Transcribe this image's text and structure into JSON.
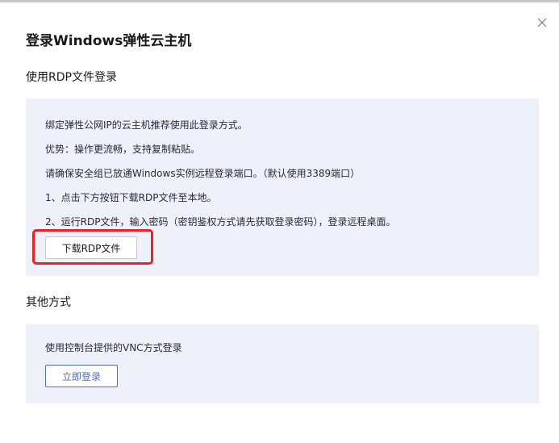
{
  "dialog": {
    "title": "登录Windows弹性云主机",
    "close_icon": "close-icon"
  },
  "rdp_section": {
    "title": "使用RDP文件登录",
    "lines": [
      "绑定弹性公网IP的云主机推荐使用此登录方式。",
      "优势：操作更流畅，支持复制粘贴。",
      "请确保安全组已放通Windows实例远程登录端口。（默认使用3389端口）",
      "1、点击下方按钮下载RDP文件至本地。",
      "2、运行RDP文件，输入密码（密钥鉴权方式请先获取登录密码），登录远程桌面。"
    ],
    "download_button": "下载RDP文件",
    "highlight_color": "#f21f1f"
  },
  "other_section": {
    "title": "其他方式",
    "description": "使用控制台提供的VNC方式登录",
    "login_button": "立即登录",
    "accent_color": "#526ecc"
  }
}
